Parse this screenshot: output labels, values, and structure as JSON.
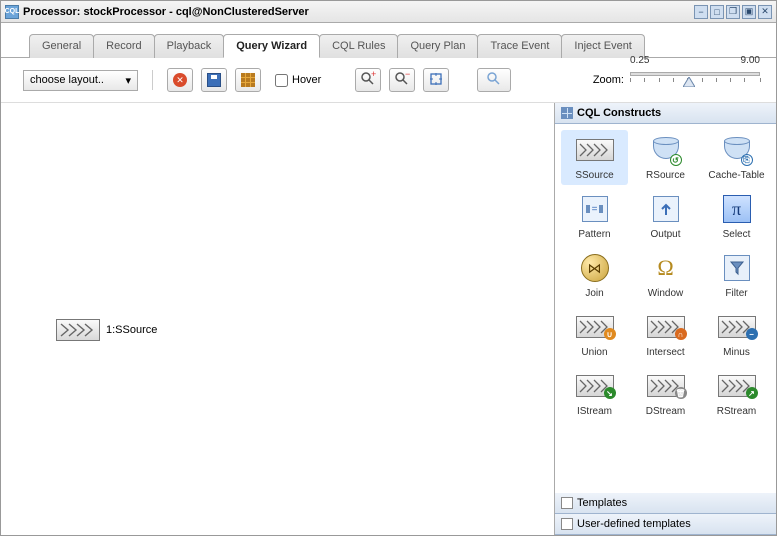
{
  "window": {
    "title": "Processor: stockProcessor - cql@NonClusteredServer",
    "icon_label": "CQL"
  },
  "tabs": [
    {
      "label": "General",
      "active": false
    },
    {
      "label": "Record",
      "active": false
    },
    {
      "label": "Playback",
      "active": false
    },
    {
      "label": "Query Wizard",
      "active": true
    },
    {
      "label": "CQL Rules",
      "active": false
    },
    {
      "label": "Query Plan",
      "active": false
    },
    {
      "label": "Trace Event",
      "active": false
    },
    {
      "label": "Inject Event",
      "active": false
    }
  ],
  "toolbar": {
    "layout_label": "choose layout..",
    "hover_label": "Hover",
    "zoom_label": "Zoom:",
    "zoom_min": "0.25",
    "zoom_max": "9.00"
  },
  "canvas": {
    "nodes": [
      {
        "label": "1:SSource"
      }
    ]
  },
  "palette": {
    "title": "CQL Constructs",
    "sections": [
      {
        "title": "Templates"
      },
      {
        "title": "User-defined templates"
      }
    ],
    "constructs": [
      {
        "label": "SSource",
        "kind": "chev",
        "selected": true
      },
      {
        "label": "RSource",
        "kind": "db",
        "badge": "↺",
        "badge_color": "#2c8a2c"
      },
      {
        "label": "Cache-Table",
        "kind": "db",
        "badge": "⎘",
        "badge_color": "#2c6fb0"
      },
      {
        "label": "Pattern",
        "kind": "pattern"
      },
      {
        "label": "Output",
        "kind": "output"
      },
      {
        "label": "Select",
        "kind": "pi"
      },
      {
        "label": "Join",
        "kind": "join"
      },
      {
        "label": "Window",
        "kind": "omega"
      },
      {
        "label": "Filter",
        "kind": "filter"
      },
      {
        "label": "Union",
        "kind": "chev",
        "badge": "∪",
        "badge_color": "#e08a1f"
      },
      {
        "label": "Intersect",
        "kind": "chev",
        "badge": "∩",
        "badge_color": "#d96a1f"
      },
      {
        "label": "Minus",
        "kind": "chev",
        "badge": "−",
        "badge_color": "#2c6fb0"
      },
      {
        "label": "IStream",
        "kind": "chev",
        "badge": "↘",
        "badge_color": "#2c8a2c"
      },
      {
        "label": "DStream",
        "kind": "chev",
        "badge": "🗑",
        "badge_color": "#888"
      },
      {
        "label": "RStream",
        "kind": "chev",
        "badge": "↗",
        "badge_color": "#2c8a2c"
      }
    ]
  }
}
